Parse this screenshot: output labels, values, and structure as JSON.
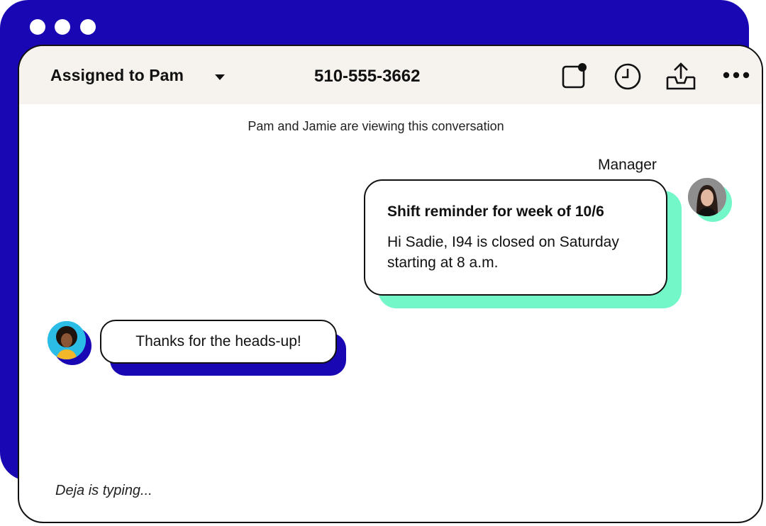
{
  "header": {
    "assignment_label": "Assigned to Pam",
    "phone_number": "510-555-3662",
    "icons": [
      "new-note-icon",
      "clock-icon",
      "inbox-upload-icon",
      "more-icon"
    ]
  },
  "conversation": {
    "viewing_status": "Pam and Jamie are viewing this conversation",
    "outgoing": {
      "sender_label": "Manager",
      "title": "Shift reminder for week of 10/6",
      "body": "Hi Sadie, I94 is closed on Saturday starting at 8 a.m."
    },
    "incoming": {
      "body": "Thanks for the heads-up!"
    },
    "typing_status": "Deja is typing..."
  },
  "colors": {
    "brand_blue": "#1a07b4",
    "mint": "#74f7c8",
    "header_bg": "#f6f2ed",
    "avatar_blue": "#2bbde5"
  }
}
